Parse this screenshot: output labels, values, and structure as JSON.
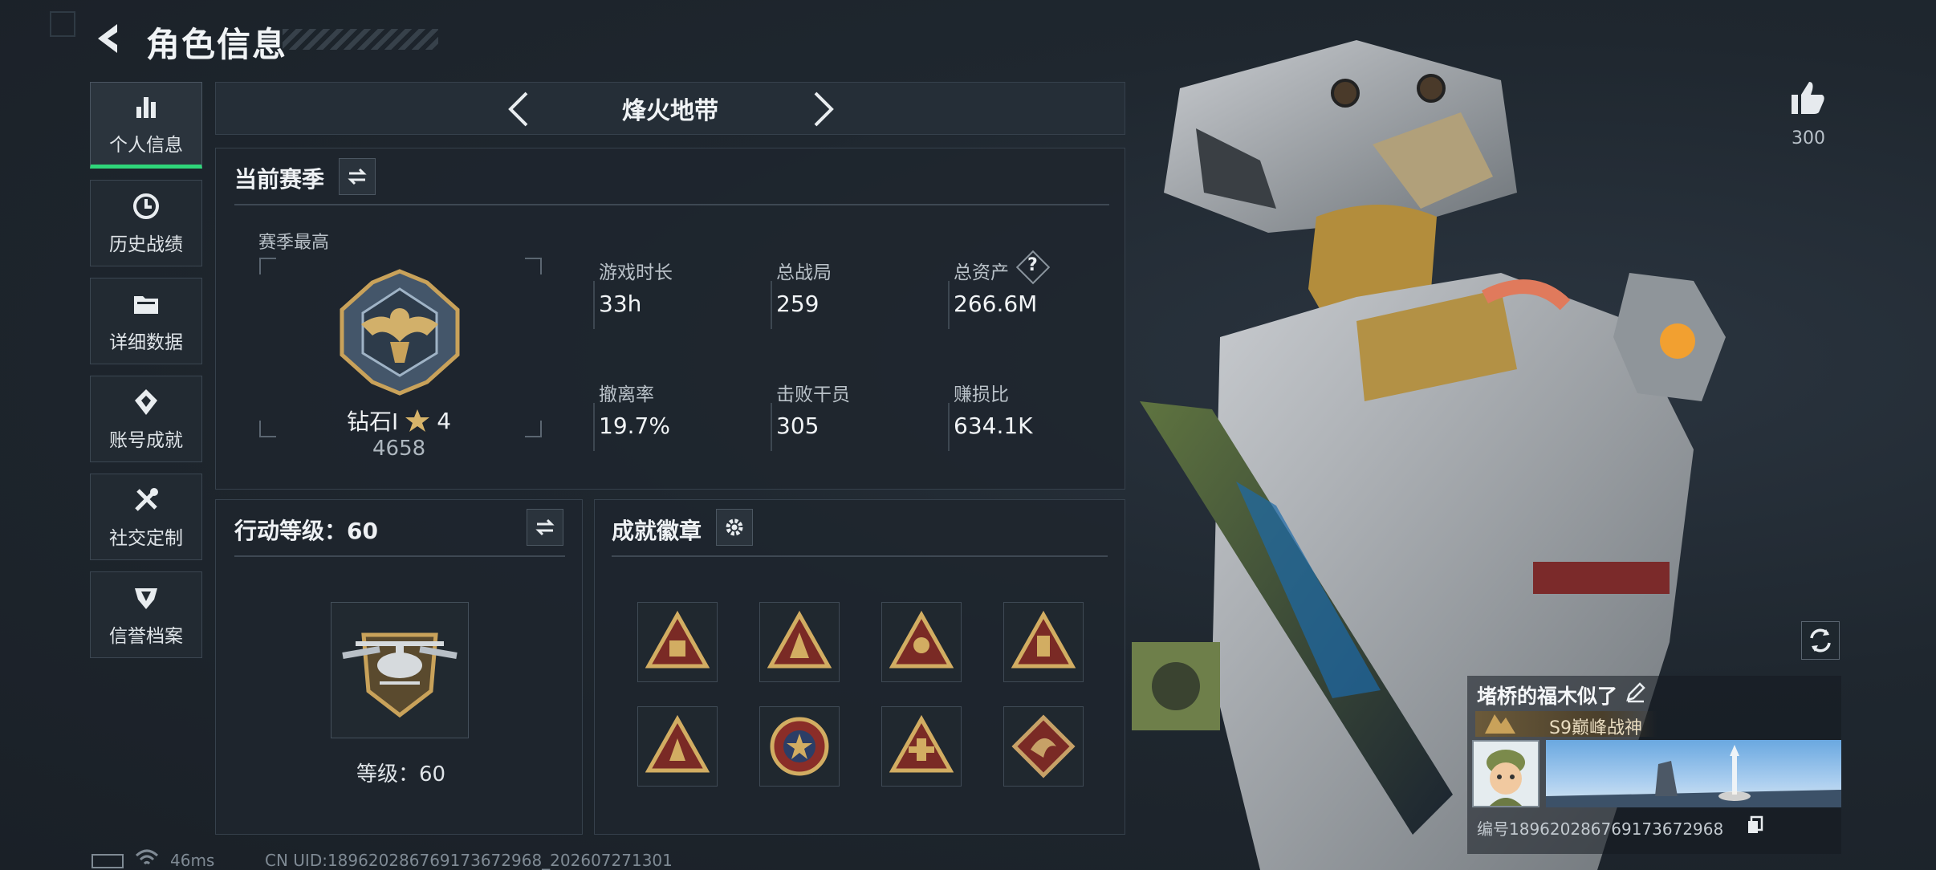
{
  "header": {
    "title": "角色信息"
  },
  "sidebar": {
    "items": [
      {
        "label": "个人信息",
        "icon": "bar-chart-icon",
        "active": true
      },
      {
        "label": "历史战绩",
        "icon": "history-icon"
      },
      {
        "label": "详细数据",
        "icon": "folder-icon"
      },
      {
        "label": "账号成就",
        "icon": "achievement-icon"
      },
      {
        "label": "社交定制",
        "icon": "tools-icon"
      },
      {
        "label": "信誉档案",
        "icon": "shield-icon"
      }
    ]
  },
  "mode": {
    "title": "烽火地带"
  },
  "season": {
    "title": "当前赛季",
    "best_label": "赛季最高",
    "rank_name": "钻石I",
    "rank_stars": "4",
    "rank_points": "4658",
    "stats": [
      {
        "label": "游戏时长",
        "value": "33h"
      },
      {
        "label": "总战局",
        "value": "259"
      },
      {
        "label": "总资产",
        "value": "266.6M",
        "help": "?"
      },
      {
        "label": "撤离率",
        "value": "19.7%"
      },
      {
        "label": "击败干员",
        "value": "305"
      },
      {
        "label": "赚损比",
        "value": "634.1K"
      }
    ]
  },
  "action_level": {
    "title": "行动等级：60",
    "level_text": "等级：60"
  },
  "badges": {
    "title": "成就徽章",
    "items": [
      "badge-triangle-1",
      "badge-triangle-2",
      "badge-triangle-3",
      "badge-triangle-4",
      "badge-triangle-5",
      "badge-round-star",
      "badge-triangle-6",
      "badge-diamond-dragon"
    ]
  },
  "footer": {
    "ping": "46ms",
    "uid": "CN UID:1896202867691736729​68_202607271301"
  },
  "profile": {
    "likes": "300",
    "name": "堵桥的福木似了",
    "rank_title": "S9巅峰战神",
    "serial": "编号1896202867691736729​68"
  },
  "colors": {
    "accent": "#2fd67a",
    "gold": "#c9a25a",
    "panel_border": "#36414c"
  }
}
